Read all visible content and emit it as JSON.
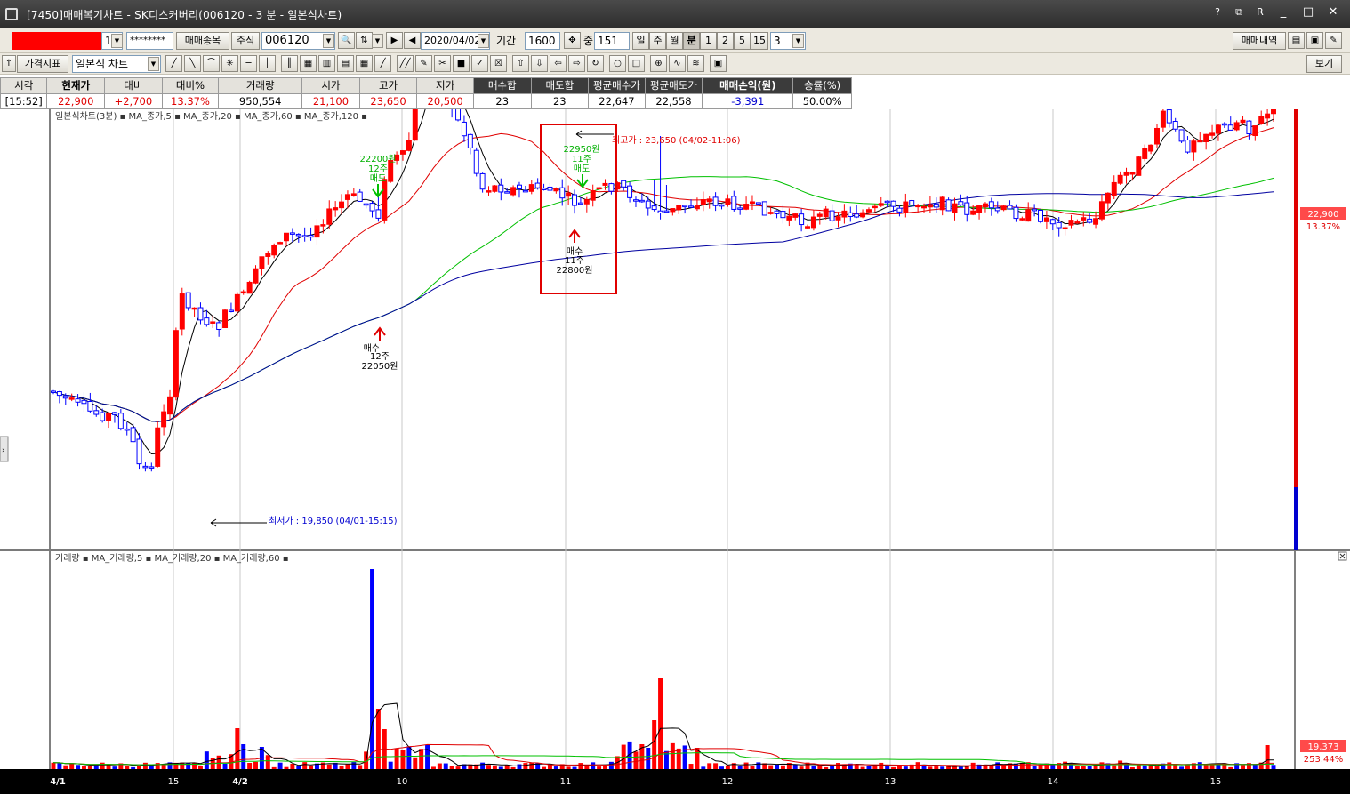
{
  "window": {
    "title": "[7450]매매복기차트 - SK디스커버리(006120 - 3 분 - 일본식차트)",
    "controls": [
      "?",
      "R",
      "_",
      "□",
      "✕"
    ]
  },
  "toolbar": {
    "account_suffix": "1",
    "password": "********",
    "trade_items_button": "매매종목",
    "market_select": "주식",
    "stock_code": "006120",
    "date": "2020/04/02",
    "period_label": "기간",
    "period_value": "1600",
    "count_label": "중",
    "count_value": "151",
    "interval_buttons": [
      "일",
      "주",
      "월",
      "분",
      "1",
      "2",
      "5",
      "15"
    ],
    "interval_selected": "분",
    "interval_value": "3",
    "trade_history_button": "매매내역",
    "indicator_button": "가격지표",
    "chart_type_select": "일본식 차트",
    "view_button": "보기"
  },
  "quote_table": {
    "headers": [
      "시각",
      "현재가",
      "대비",
      "대비%",
      "거래량",
      "시가",
      "고가",
      "저가",
      "매수합",
      "매도합",
      "평균매수가",
      "평균매도가",
      "매매손익(원)",
      "승률(%)"
    ],
    "values": [
      "[15:52]",
      "22,900",
      "+2,700",
      "13.37%",
      "950,554",
      "21,100",
      "23,650",
      "20,500",
      "23",
      "23",
      "22,647",
      "22,558",
      "-3,391",
      "50.00%"
    ]
  },
  "price_panel": {
    "legend": "일본식차트(3분) ▪ MA_종가,5 ▪ MA_종가,20 ▪ MA_종가,60 ▪ MA_종가,120 ▪",
    "high_annotation": "최고가 : 23,650 (04/02-11:06)",
    "low_annotation": "최저가 : 19,850 (04/01-15:15)",
    "last_price": "22,900",
    "last_pct": "13.37%",
    "markers": [
      {
        "price": "22200원",
        "qty": "12주",
        "side": "매도"
      },
      {
        "price": "22950원",
        "qty": "11주",
        "side": "매도"
      },
      {
        "price": "22050원",
        "qty": "12주",
        "side": "매수"
      },
      {
        "price": "22800원",
        "qty": "11주",
        "side": "매수"
      }
    ]
  },
  "volume_panel": {
    "legend": "거래량 ▪ MA_거래량,5 ▪ MA_거래량,20 ▪ MA_거래량,60 ▪",
    "last_volume": "19,373",
    "last_pct": "253.44%"
  },
  "x_axis_labels": [
    {
      "label": "4/1",
      "bold": true
    },
    {
      "label": "15",
      "bold": false
    },
    {
      "label": "4/2",
      "bold": true
    },
    {
      "label": "10",
      "bold": false
    },
    {
      "label": "11",
      "bold": false
    },
    {
      "label": "12",
      "bold": false
    },
    {
      "label": "13",
      "bold": false
    },
    {
      "label": "14",
      "bold": false
    },
    {
      "label": "15",
      "bold": false
    }
  ],
  "colors": {
    "up": "#ff0000",
    "down": "#0000ff",
    "ma5": "#000000",
    "ma20": "#e00000",
    "ma60": "#00c000",
    "ma120": "#0000a0",
    "highlight_box": "#e00000"
  }
}
